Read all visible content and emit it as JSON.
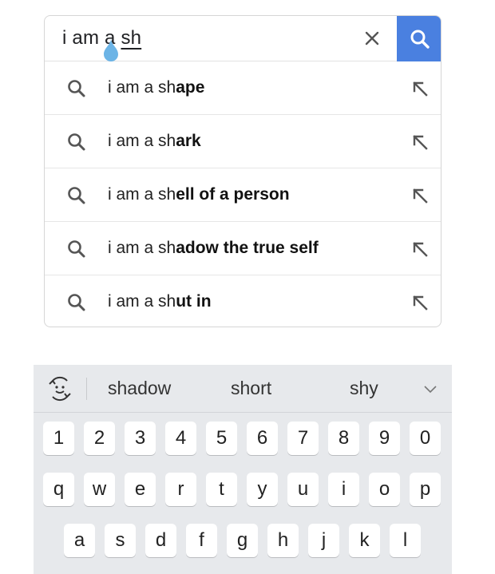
{
  "search": {
    "query_prefix": "i am a ",
    "query_composing": "sh"
  },
  "suggestions": [
    {
      "prefix": "i am a sh",
      "completion": "ape"
    },
    {
      "prefix": "i am a sh",
      "completion": "ark"
    },
    {
      "prefix": "i am a sh",
      "completion": "ell of a person"
    },
    {
      "prefix": "i am a sh",
      "completion": "adow the true self"
    },
    {
      "prefix": "i am a sh",
      "completion": "ut in"
    }
  ],
  "keyboard": {
    "word_suggestions": [
      "shadow",
      "short",
      "shy"
    ],
    "number_row": [
      "1",
      "2",
      "3",
      "4",
      "5",
      "6",
      "7",
      "8",
      "9",
      "0"
    ],
    "row1": [
      "q",
      "w",
      "e",
      "r",
      "t",
      "y",
      "u",
      "i",
      "o",
      "p"
    ],
    "row2": [
      "a",
      "s",
      "d",
      "f",
      "g",
      "h",
      "j",
      "k",
      "l"
    ]
  },
  "colors": {
    "search_button": "#4a80e0",
    "cursor_handle": "#6cb4e6",
    "keyboard_bg": "#e7e9ec"
  },
  "icons": [
    "clear-icon",
    "search-icon",
    "magnifier-icon",
    "fill-arrow-icon",
    "emoji-switch-icon",
    "chevron-down-icon"
  ]
}
